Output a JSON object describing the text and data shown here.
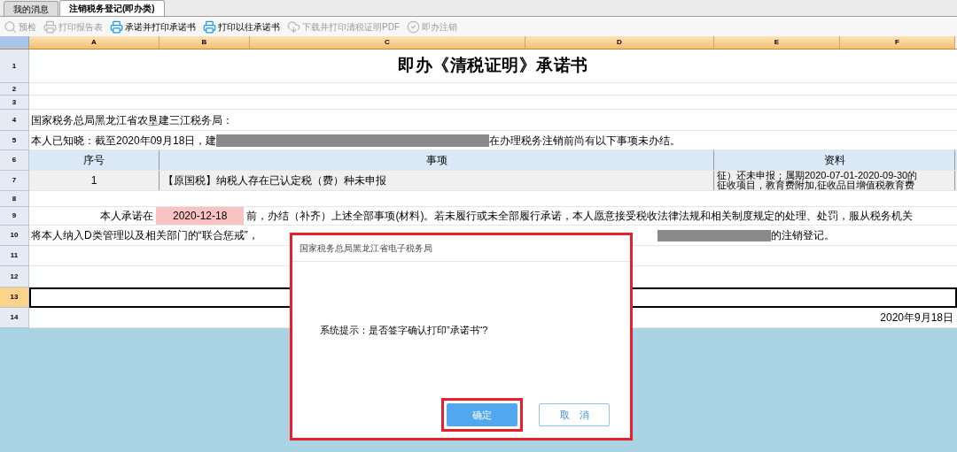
{
  "tabs": [
    {
      "label": "我的消息",
      "selected": false
    },
    {
      "label": "注销税务登记(即办类)",
      "selected": true
    }
  ],
  "toolbar": [
    {
      "kind": "search",
      "label": "预检",
      "disabled": true
    },
    {
      "kind": "print",
      "label": "打印报告表",
      "disabled": true
    },
    {
      "kind": "print",
      "label": "承诺并打印承诺书",
      "disabled": false
    },
    {
      "kind": "print",
      "label": "打印以往承诺书",
      "disabled": false
    },
    {
      "kind": "download",
      "label": "下载并打印清税证明PDF",
      "disabled": true
    },
    {
      "kind": "check",
      "label": "即办注销",
      "disabled": true
    }
  ],
  "columns": [
    "A",
    "B",
    "C",
    "D",
    "E",
    "F"
  ],
  "rows": [
    {
      "number": "1",
      "selected": false,
      "kind": "title",
      "title": "即办《清税证明》承诺书"
    },
    {
      "number": "2",
      "selected": false,
      "kind": "blank"
    },
    {
      "number": "3",
      "selected": false,
      "kind": "blank"
    },
    {
      "number": "4",
      "selected": false,
      "kind": "text",
      "text": "国家税务总局黑龙江省农垦建三江税务局："
    },
    {
      "number": "5",
      "selected": false,
      "kind": "notice",
      "before": "本人已知晓：截至2020年09月18日，建",
      "after": "在办理税务注销前尚有以下事项未办结。"
    },
    {
      "number": "6",
      "selected": false,
      "kind": "table_head",
      "cells": [
        "序号",
        "事项",
        "资料"
      ]
    },
    {
      "number": "7",
      "selected": false,
      "kind": "table_row",
      "cells": [
        "1",
        "【原国税】纳税人存在已认定税（费）种未申报"
      ],
      "lines": [
        "征）还未申报；属期2020-07-01-2020-09-30的",
        "征收项目，教育费附加,征收品目增值税教育费"
      ]
    },
    {
      "number": "8",
      "selected": false,
      "kind": "blank"
    },
    {
      "number": "9",
      "selected": false,
      "kind": "promise",
      "before": "本人承诺在",
      "date": "2020-12-18",
      "after": "前，办结（补齐）上述全部事项(材料)。若未履行或未全部履行承诺，本人愿意接受税收法律法规和相关制度规定的处理、处罚，服从税务机关"
    },
    {
      "number": "10",
      "selected": false,
      "kind": "line",
      "before": "将本人纳入D类管理以及相关部门的“联合惩戒”，",
      "after": "的注销登记。"
    },
    {
      "number": "11",
      "selected": false,
      "kind": "blank"
    },
    {
      "number": "12",
      "selected": false,
      "kind": "blank"
    },
    {
      "number": "13",
      "selected": true,
      "kind": "blank"
    },
    {
      "number": "14",
      "selected": false,
      "kind": "date",
      "text": "2020年9月18日"
    }
  ],
  "dialog": {
    "title": "国家税务总局黑龙江省电子税务局",
    "message": "系统提示：是否签字确认打印”承诺书“?",
    "buttons": [
      {
        "label": "确定",
        "primary": true,
        "highlighted": true
      },
      {
        "label": "取　消",
        "primary": false,
        "highlighted": false
      }
    ]
  }
}
